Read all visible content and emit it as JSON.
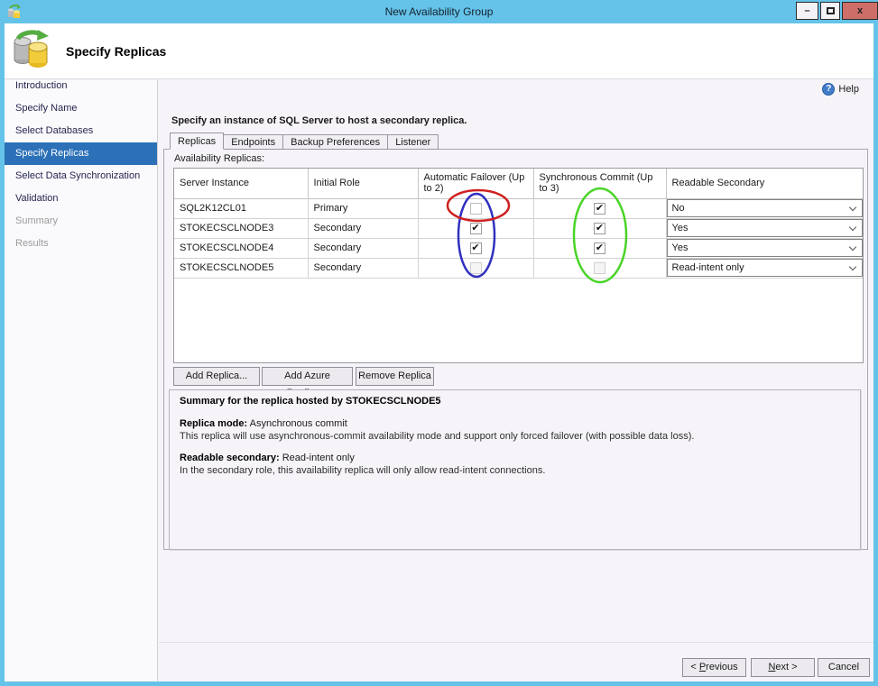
{
  "window": {
    "title": "New Availability Group"
  },
  "icons": {
    "minimize": "–",
    "close": "x",
    "help": "?"
  },
  "header": {
    "title": "Specify Replicas"
  },
  "sidebar": {
    "items": [
      {
        "label": "Introduction",
        "state": "enabled"
      },
      {
        "label": "Specify Name",
        "state": "enabled"
      },
      {
        "label": "Select Databases",
        "state": "enabled"
      },
      {
        "label": "Specify Replicas",
        "state": "selected"
      },
      {
        "label": "Select Data Synchronization",
        "state": "enabled"
      },
      {
        "label": "Validation",
        "state": "enabled"
      },
      {
        "label": "Summary",
        "state": "disabled"
      },
      {
        "label": "Results",
        "state": "disabled"
      }
    ]
  },
  "main": {
    "help_label": "Help",
    "instruction": "Specify an instance of SQL Server to host a secondary replica.",
    "tabs": [
      {
        "label": "Replicas",
        "active": true
      },
      {
        "label": "Endpoints",
        "active": false
      },
      {
        "label": "Backup Preferences",
        "active": false
      },
      {
        "label": "Listener",
        "active": false
      }
    ],
    "grid_label": "Availability Replicas:",
    "table": {
      "columns": [
        "Server Instance",
        "Initial Role",
        "Automatic Failover (Up to 2)",
        "Synchronous Commit (Up to 3)",
        "Readable Secondary"
      ],
      "rows": [
        {
          "server": "SQL2K12CL01",
          "role": "Primary",
          "af_checked": false,
          "af_disabled": false,
          "sc_checked": true,
          "sc_disabled": false,
          "readable": "No"
        },
        {
          "server": "STOKECSCLNODE3",
          "role": "Secondary",
          "af_checked": true,
          "af_disabled": false,
          "sc_checked": true,
          "sc_disabled": false,
          "readable": "Yes"
        },
        {
          "server": "STOKECSCLNODE4",
          "role": "Secondary",
          "af_checked": true,
          "af_disabled": false,
          "sc_checked": true,
          "sc_disabled": false,
          "readable": "Yes"
        },
        {
          "server": "STOKECSCLNODE5",
          "role": "Secondary",
          "af_checked": false,
          "af_disabled": true,
          "sc_checked": false,
          "sc_disabled": true,
          "readable": "Read-intent only"
        }
      ]
    },
    "replica_buttons": {
      "add": "Add Replica...",
      "add_azure": "Add Azure Replica...",
      "remove": "Remove Replica"
    },
    "summary": {
      "title": "Summary for the replica hosted by STOKECSCLNODE5",
      "mode_label": "Replica mode:",
      "mode_value": " Asynchronous commit",
      "mode_desc": "This replica will use asynchronous-commit availability mode and support only forced failover (with possible data loss).",
      "readable_label": "Readable secondary:",
      "readable_value": " Read-intent only",
      "readable_desc": "In the secondary role, this availability replica will only allow read-intent connections."
    },
    "footer": {
      "previous_pre": "< ",
      "previous_key": "P",
      "previous_rest": "revious",
      "next_key": "N",
      "next_rest": "ext >",
      "cancel": "Cancel"
    }
  },
  "annotations": {
    "red": "#cf2020",
    "blue": "#3030bf",
    "green": "#4ad428"
  }
}
